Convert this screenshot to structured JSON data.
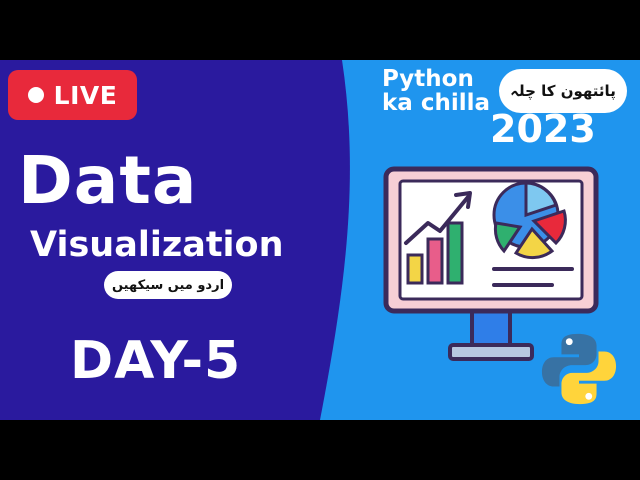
{
  "badge": {
    "live_label": "LIVE"
  },
  "title": {
    "line1": "Data",
    "line2": "Visualization"
  },
  "subtitle_urdu": "اردو میں سیکھیں",
  "day_label": "DAY-5",
  "course": {
    "name_line1": "Python",
    "name_line2": "ka chilla",
    "urdu_name": "پائتھون کا چلہ",
    "year": "2023"
  },
  "icons": [
    "live-dot-icon",
    "monitor-chart-icon",
    "python-logo-icon"
  ],
  "colors": {
    "left_panel": "#2a1a9e",
    "right_panel": "#1f95ee",
    "live_red": "#e8293b",
    "monitor_border": "#3b2a5a"
  }
}
